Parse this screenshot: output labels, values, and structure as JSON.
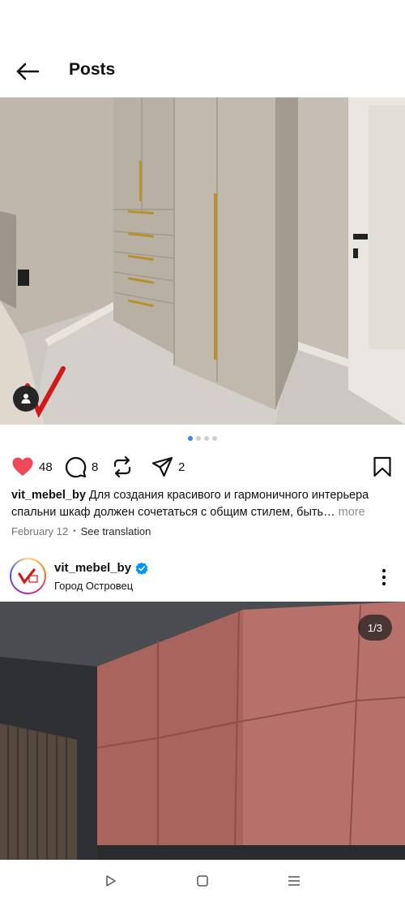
{
  "header": {
    "title": "Posts"
  },
  "post1": {
    "actions": {
      "likes": "48",
      "comments": "8",
      "shares": "2"
    },
    "colors": {
      "like": "#ed4956"
    },
    "caption": {
      "username": "vit_mebel_by",
      "text": "Для создания красивого и гармоничного интерьера спальни шкаф должен сочетаться с общим стилем, быть…",
      "more": "more"
    },
    "date": "February 12",
    "see_translation": "See translation",
    "carousel": {
      "total": 4,
      "active": 1
    }
  },
  "post2": {
    "username": "vit_mebel_by",
    "location": "Город Островец",
    "counter": "1/3",
    "verified_color": "#0095f6"
  },
  "navbar": {
    "icons": [
      "back-triangle-icon",
      "home-square-icon",
      "menu-lines-icon"
    ]
  }
}
